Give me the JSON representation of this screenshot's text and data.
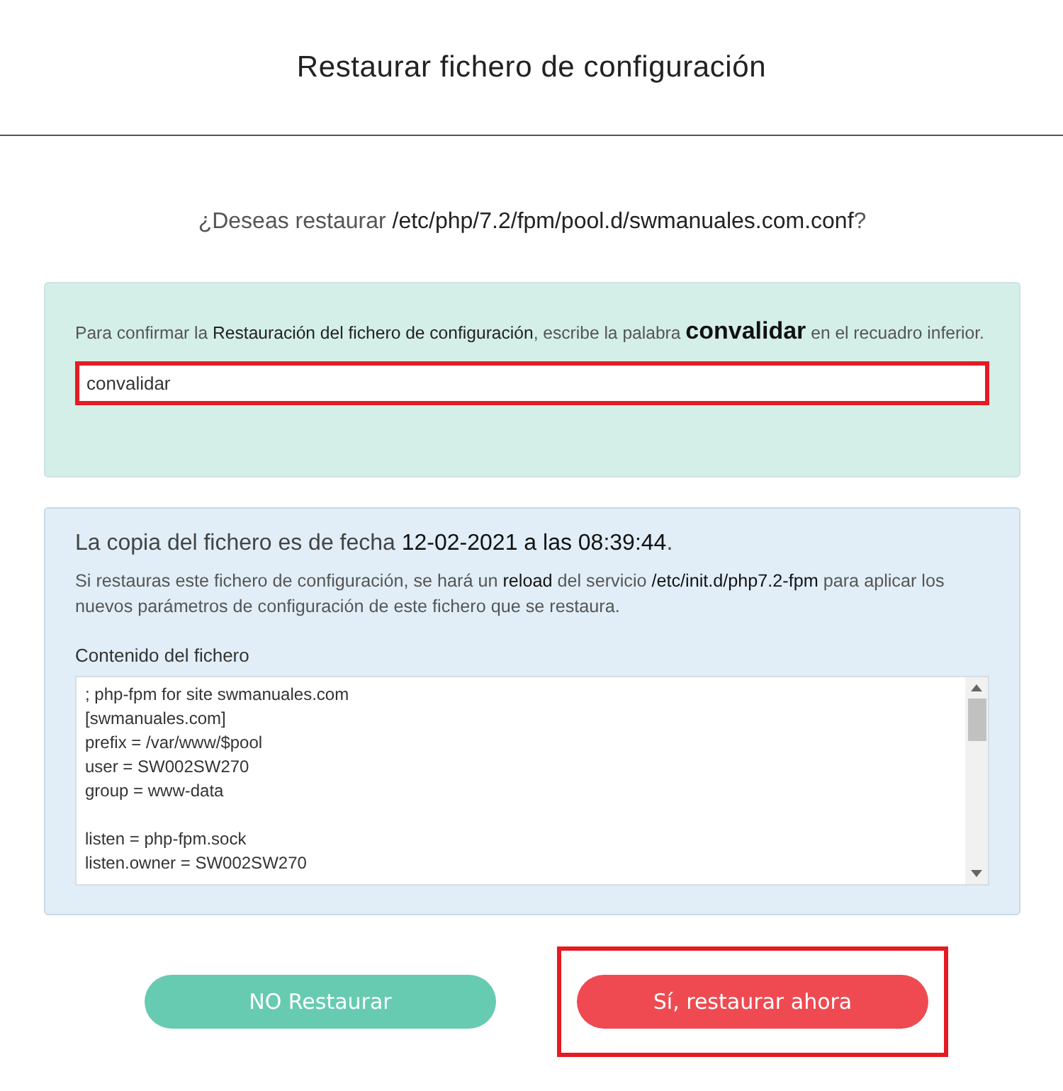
{
  "dialog": {
    "title": "Restaurar fichero de configuración"
  },
  "question": "¿Deseas restaurar **/etc/php/7.2/fpm/pool.d/swmanuales.com.conf**?",
  "confirm_panel": {
    "instruction": "Para confirmar la **Restauración del fichero de configuración**, escribe la palabra",
    "keyword": "convalidar",
    "instruction_end": "en el recuadro inferior.",
    "field": {
      "value": "convalidar",
      "highlighted": true
    }
  },
  "info_panel": {
    "date_line": "La copia del fichero es de fecha **12-02-2021 a las 08:39:44**.",
    "note": "Si restauras este fichero de configuración, se hará un **reload** del servicio **/etc/init.d/php7.2-fpm** para aplicar los nuevos parámetros de configuración de este fichero que se restaura.",
    "content_label": "Contenido del fichero",
    "content_lines": [
      {
        "text": "; php-fpm for site swmanuales.com",
        "space_before": false
      },
      {
        "text": "[swmanuales.com]",
        "space_before": false
      },
      {
        "text": "prefix = /var/www/$pool",
        "space_before": false
      },
      {
        "text": "user = SW002SW270",
        "space_before": false
      },
      {
        "text": "group = www-data",
        "space_before": false
      },
      {
        "text": "listen = php-fpm.sock",
        "space_before": true
      },
      {
        "text": "listen.owner = SW002SW270",
        "space_before": false
      }
    ]
  },
  "buttons": [
    {
      "label": "NO Restaurar",
      "kind": "cancel",
      "highlighted": false
    },
    {
      "label": "Sí, restaurar ahora",
      "kind": "confirm",
      "highlighted": true
    }
  ]
}
